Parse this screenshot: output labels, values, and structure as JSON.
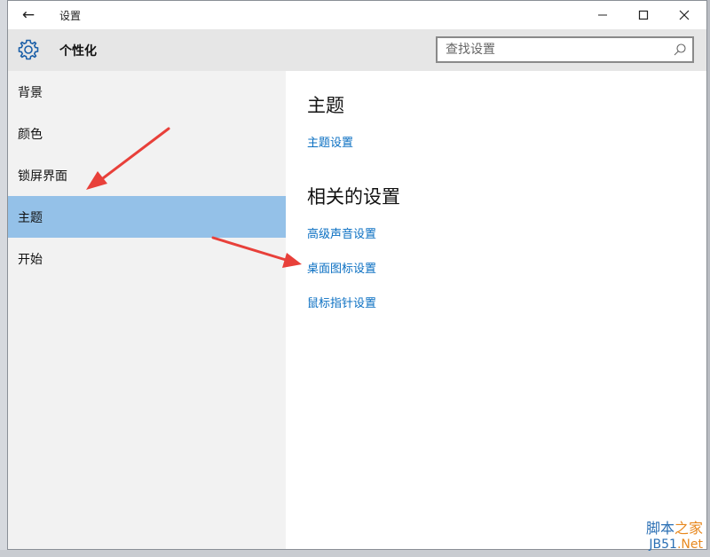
{
  "window": {
    "title": "设置",
    "controls": {
      "minimize": "–",
      "maximize": "☐",
      "close": "✕"
    }
  },
  "header": {
    "title": "个性化",
    "search_placeholder": "查找设置"
  },
  "sidebar": {
    "items": [
      {
        "label": "背景",
        "active": false
      },
      {
        "label": "颜色",
        "active": false
      },
      {
        "label": "锁屏界面",
        "active": false
      },
      {
        "label": "主题",
        "active": true
      },
      {
        "label": "开始",
        "active": false
      }
    ]
  },
  "content": {
    "section1_title": "主题",
    "theme_settings_link": "主题设置",
    "section2_title": "相关的设置",
    "related_links": [
      "高级声音设置",
      "桌面图标设置",
      "鼠标指针设置"
    ]
  },
  "watermark": {
    "line1_a": "脚本",
    "line1_b": "之家",
    "line2_a": "JB51",
    "line2_b": ".Net"
  },
  "colors": {
    "active_item": "#94c1e8",
    "link": "#0a6fc2",
    "annotation_arrow": "#e8403a"
  }
}
